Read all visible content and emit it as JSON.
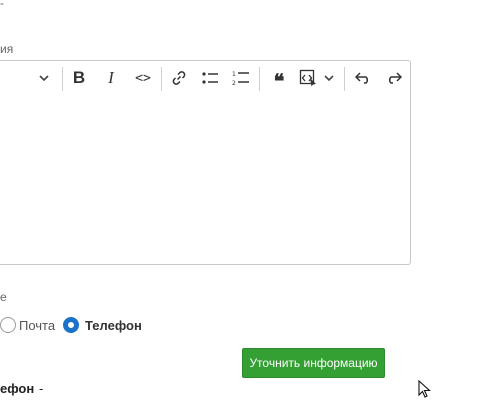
{
  "fragments": {
    "top_dash": "-",
    "field_label": "ия",
    "section_label": "е",
    "bottom_label": "ефон",
    "bottom_dash": "-"
  },
  "toolbar": {
    "bold": "B",
    "italic": "I",
    "code": "<>",
    "blockquote": "❝"
  },
  "contact": {
    "options": [
      {
        "label": "Почта",
        "selected": false
      },
      {
        "label": "Телефон",
        "selected": true
      }
    ]
  },
  "actions": {
    "clarify_label": "Уточнить информацию"
  },
  "colors": {
    "accent_green": "#34a034",
    "radio_selected": "#1a73c9"
  }
}
